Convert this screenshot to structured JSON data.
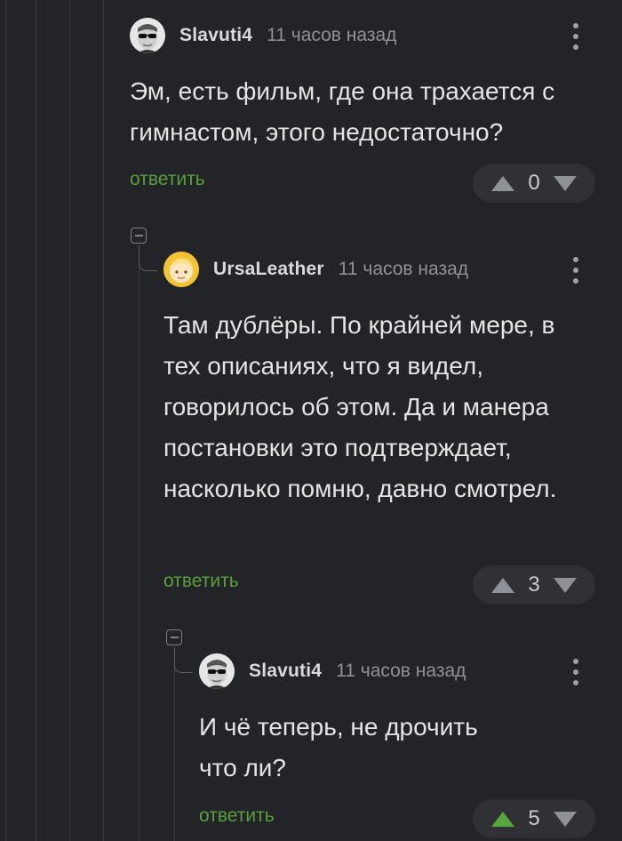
{
  "comments": [
    {
      "username": "Slavuti4",
      "time": "11 часов назад",
      "text": "Эм, есть фильм, где она трахается с гимнастом, этого недостаточно?",
      "reply_label": "ответить",
      "votes": "0",
      "upvoted": false,
      "avatar": "sunglasses-man-avatar"
    },
    {
      "username": "UrsaLeather",
      "time": "11 часов назад",
      "text": "Там дублёры. По крайней мере, в тех описаниях, что я видел, говорилось об этом. Да и манера постановки это подтверждает, насколько помню, давно смотрел.",
      "reply_label": "ответить",
      "votes": "3",
      "upvoted": false,
      "avatar": "cartoon-blonde-avatar"
    },
    {
      "username": "Slavuti4",
      "time": "11 часов назад",
      "text": "И чё теперь, не дрочить что ли?",
      "reply_label": "ответить",
      "votes": "5",
      "upvoted": true,
      "avatar": "sunglasses-man-avatar"
    }
  ],
  "colors": {
    "background": "#222428",
    "reply_link": "#5b9f3c",
    "upvote_active": "#58a63a",
    "vote_box": "#2f3135"
  }
}
